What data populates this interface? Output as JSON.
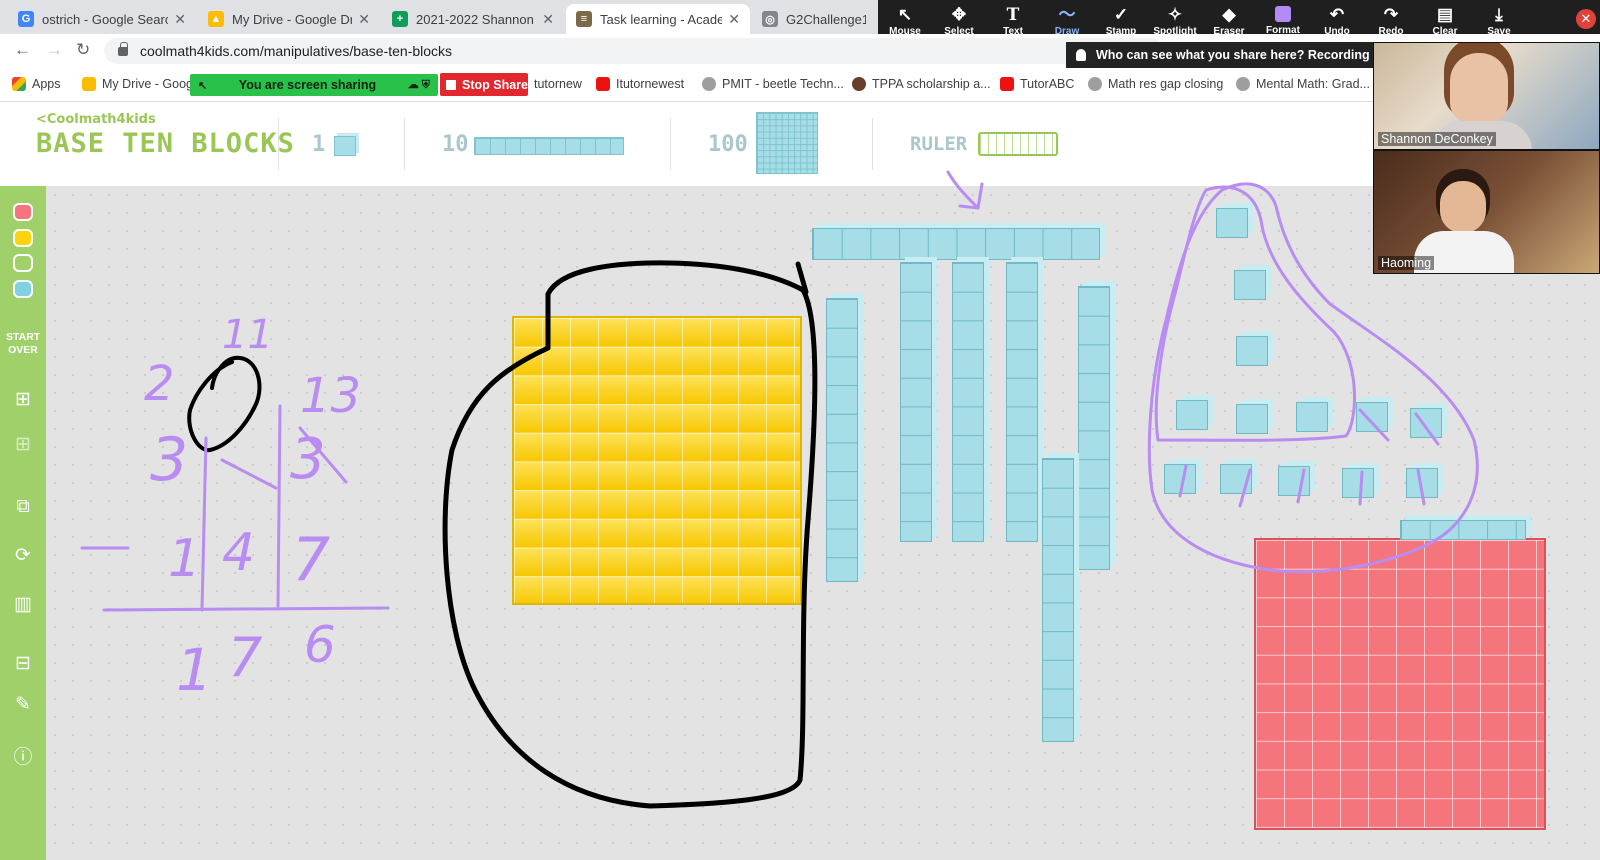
{
  "browser": {
    "tabs": [
      {
        "title": "ostrich - Google Search",
        "icon": "google-icon",
        "color": "#4285f4",
        "active": false
      },
      {
        "title": "My Drive - Google Drive",
        "icon": "drive-icon",
        "color": "#fbbc04",
        "active": false
      },
      {
        "title": "2021-2022 Shannon De",
        "icon": "sheets-icon",
        "color": "#0f9d58",
        "active": false
      },
      {
        "title": "Task learning - Academ",
        "icon": "doc-icon",
        "color": "#7a6a4a",
        "active": true
      },
      {
        "title": "G2Challenge1-",
        "icon": "globe-icon",
        "color": "#80868b",
        "active": false
      }
    ],
    "url": "coolmath4kids.com/manipulatives/base-ten-blocks",
    "bookmarks": [
      {
        "label": "Apps",
        "icon": "apps-icon"
      },
      {
        "label": "My Drive - Goog",
        "icon": "drive-icon"
      },
      {
        "label": "tutornew",
        "icon": "bookmark-icon"
      },
      {
        "label": "Itutornewest",
        "icon": "i-bookmark-icon"
      },
      {
        "label": "PMIT - beetle Techn...",
        "icon": "globe-icon"
      },
      {
        "label": "TPPA scholarship a...",
        "icon": "shield-icon"
      },
      {
        "label": "TutorABC",
        "icon": "i-bookmark-icon"
      },
      {
        "label": "Math res gap closing",
        "icon": "globe-icon"
      },
      {
        "label": "Mental Math: Grad...",
        "icon": "globe-icon"
      }
    ]
  },
  "screenshare": {
    "sharing_label": "You are screen sharing",
    "stop_label": "Stop Share",
    "notice": "Who can see what you share here? Recording On"
  },
  "zoom_toolbar": {
    "tools": [
      {
        "label": "Mouse",
        "icon": "cursor-icon",
        "glyph": "↖",
        "active": false
      },
      {
        "label": "Select",
        "icon": "move-icon",
        "glyph": "✥",
        "active": false
      },
      {
        "label": "Text",
        "icon": "text-icon",
        "glyph": "T",
        "active": false
      },
      {
        "label": "Draw",
        "icon": "draw-icon",
        "glyph": "〜",
        "active": true
      },
      {
        "label": "Stamp",
        "icon": "check-icon",
        "glyph": "✓",
        "active": false
      },
      {
        "label": "Spotlight",
        "icon": "spotlight-icon",
        "glyph": "✧",
        "active": false
      },
      {
        "label": "Eraser",
        "icon": "eraser-icon",
        "glyph": "⌫",
        "active": false
      },
      {
        "label": "Format",
        "icon": "format-icon",
        "glyph": "",
        "active": false
      },
      {
        "label": "Undo",
        "icon": "undo-icon",
        "glyph": "↶",
        "active": false
      },
      {
        "label": "Redo",
        "icon": "redo-icon",
        "glyph": "↷",
        "active": false
      },
      {
        "label": "Clear",
        "icon": "trash-icon",
        "glyph": "🗑",
        "active": false
      },
      {
        "label": "Save",
        "icon": "save-icon",
        "glyph": "⤓",
        "active": false
      }
    ],
    "format_color": "#b38bf7"
  },
  "app": {
    "brand": "<Coolmath4kids",
    "title": "BASE TEN BLOCKS",
    "palette": [
      {
        "label": "1"
      },
      {
        "label": "10"
      },
      {
        "label": "100"
      },
      {
        "label": "RULER"
      }
    ],
    "sidebar_colors": [
      "#f4767c",
      "#fdd40c",
      "#9fd06a",
      "#7fd3e0"
    ],
    "start_over": "START OVER",
    "sidebar_tools": [
      "group-icon",
      "ungroup-icon",
      "duplicate-icon",
      "rotate-icon",
      "trash-icon",
      "split-icon",
      "pencil-icon",
      "help-icon"
    ],
    "accent": "#9ac655"
  },
  "board": {
    "handwriting": [
      "11",
      "2",
      "3",
      "13",
      "3",
      "1",
      "4",
      "7",
      "1",
      "7",
      "6"
    ],
    "blocks": {
      "hundreds_yellow": 1,
      "hundreds_red": 1,
      "tens_vertical": 6,
      "tens_horizontal": 2,
      "ones": 13
    },
    "drawing_color": "#b98cf2"
  },
  "participants": [
    {
      "name": "Shannon DeConkey"
    },
    {
      "name": "Haoming"
    }
  ]
}
